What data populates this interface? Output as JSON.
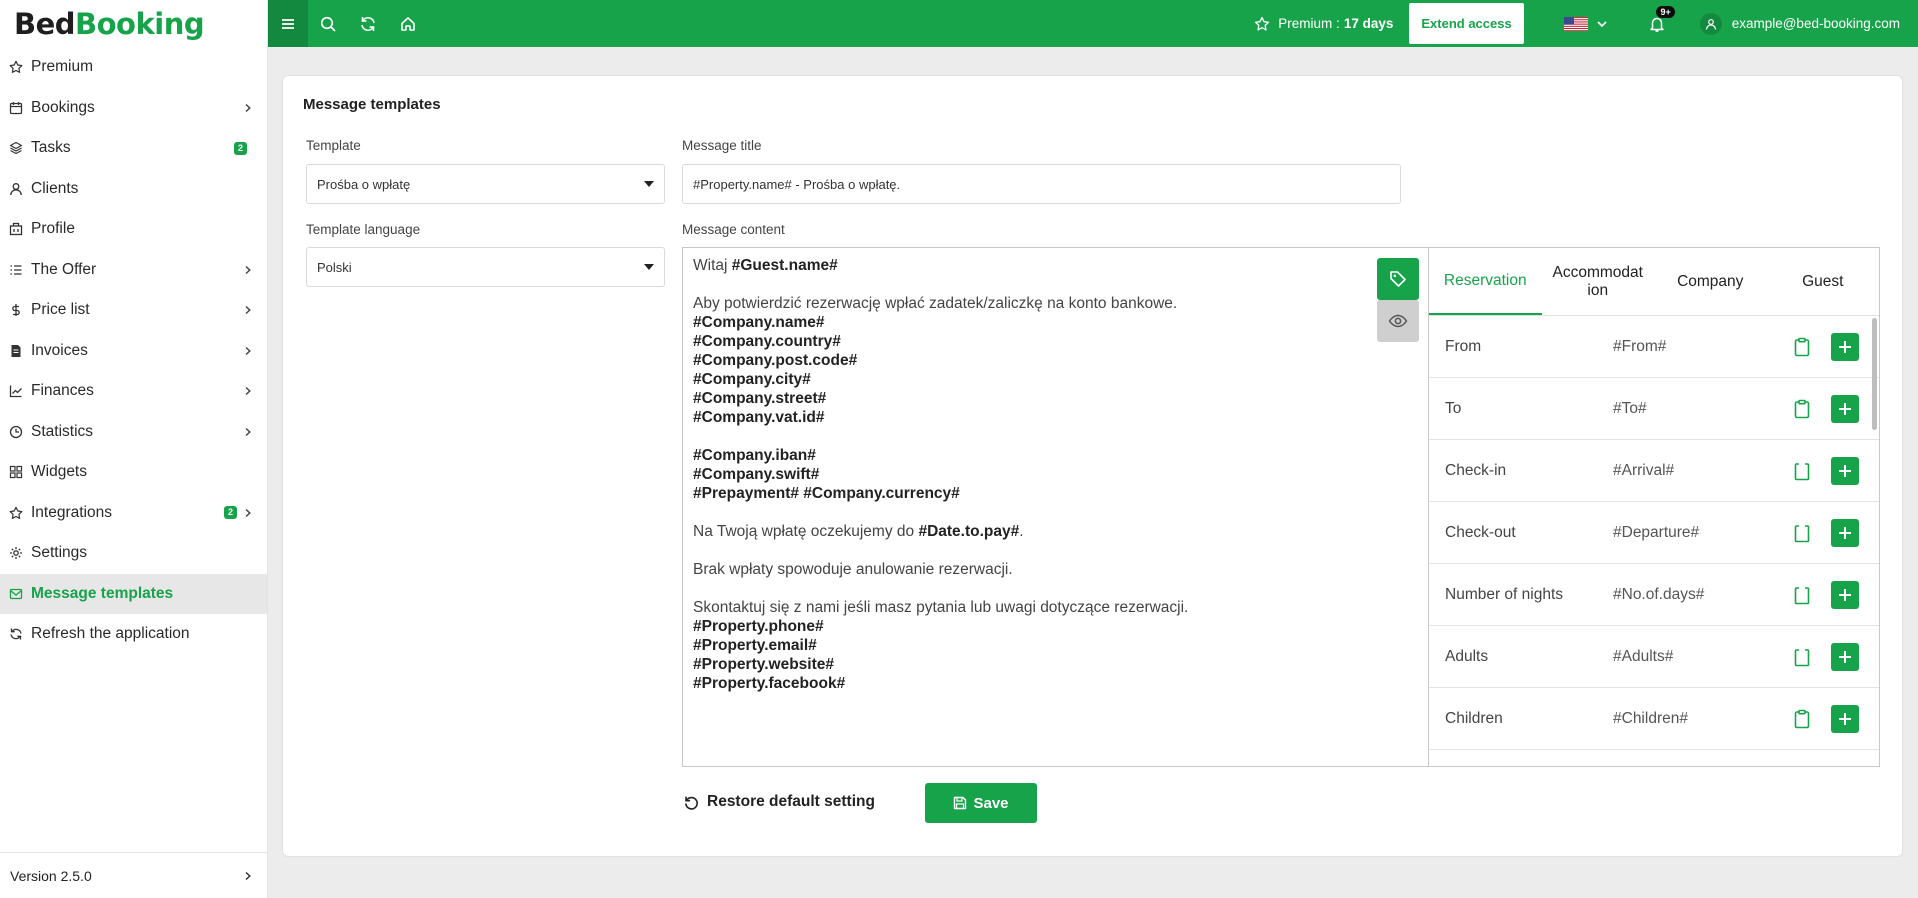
{
  "brand": {
    "part1": "Bed",
    "part2": "Booking"
  },
  "sidebar": {
    "items": [
      {
        "label": "Premium",
        "icon": "star-icon"
      },
      {
        "label": "Bookings",
        "icon": "calendar-icon",
        "chevron": true
      },
      {
        "label": "Tasks",
        "icon": "layers-icon",
        "badge": "2"
      },
      {
        "label": "Clients",
        "icon": "user-icon"
      },
      {
        "label": "Profile",
        "icon": "building-icon"
      },
      {
        "label": "The Offer",
        "icon": "list-icon",
        "chevron": true
      },
      {
        "label": "Price list",
        "icon": "dollar-icon",
        "chevron": true
      },
      {
        "label": "Invoices",
        "icon": "invoice-icon",
        "chevron": true
      },
      {
        "label": "Finances",
        "icon": "chart-icon",
        "chevron": true
      },
      {
        "label": "Statistics",
        "icon": "clock-icon",
        "chevron": true
      },
      {
        "label": "Widgets",
        "icon": "grid-icon"
      },
      {
        "label": "Integrations",
        "icon": "star-icon",
        "badge": "2",
        "chevron": true
      },
      {
        "label": "Settings",
        "icon": "gear-icon"
      },
      {
        "label": "Message templates",
        "icon": "mail-icon",
        "active": true
      },
      {
        "label": "Refresh the application",
        "icon": "refresh-icon"
      }
    ],
    "version": "Version 2.5.0"
  },
  "topbar": {
    "premium_label": "Premium :",
    "premium_days": "17 days",
    "extend_label": "Extend access",
    "notifications": "9+",
    "user_email": "example@bed-booking.com"
  },
  "page": {
    "title": "Message templates",
    "template_label": "Template",
    "template_value": "Prośba o wpłatę",
    "language_label": "Template language",
    "language_value": "Polski",
    "msg_title_label": "Message title",
    "msg_title_value": "#Property.name# - Prośba o wpłatę.",
    "msg_content_label": "Message content",
    "restore_label": "Restore default setting",
    "save_label": "Save"
  },
  "editor": {
    "lines": [
      [
        {
          "t": "Witaj "
        },
        {
          "t": "#Guest.name#",
          "b": true
        }
      ],
      [],
      [
        {
          "t": "Aby potwierdzić rezerwację wpłać zadatek/zaliczkę na konto bankowe."
        }
      ],
      [
        {
          "t": "#Company.name#",
          "b": true
        }
      ],
      [
        {
          "t": "#Company.country#",
          "b": true
        }
      ],
      [
        {
          "t": "#Company.post.code#",
          "b": true
        }
      ],
      [
        {
          "t": "#Company.city#",
          "b": true
        }
      ],
      [
        {
          "t": "#Company.street#",
          "b": true
        }
      ],
      [
        {
          "t": "#Company.vat.id#",
          "b": true
        }
      ],
      [],
      [
        {
          "t": "#Company.iban#",
          "b": true
        }
      ],
      [
        {
          "t": "#Company.swift#",
          "b": true
        }
      ],
      [
        {
          "t": "#Prepayment# #Company.currency#",
          "b": true
        }
      ],
      [],
      [
        {
          "t": "Na Twoją wpłatę oczekujemy do "
        },
        {
          "t": "#Date.to.pay#",
          "b": true
        },
        {
          "t": "."
        }
      ],
      [],
      [
        {
          "t": "Brak wpłaty spowoduje anulowanie rezerwacji."
        }
      ],
      [],
      [
        {
          "t": "Skontaktuj się z nami jeśli masz pytania lub uwagi dotyczące rezerwacji."
        }
      ],
      [
        {
          "t": "#Property.phone#",
          "b": true
        }
      ],
      [
        {
          "t": "#Property.email#",
          "b": true
        }
      ],
      [
        {
          "t": "#Property.website#",
          "b": true
        }
      ],
      [
        {
          "t": "#Property.facebook#",
          "b": true
        }
      ]
    ]
  },
  "variables": {
    "tabs": [
      {
        "label": "Reservation",
        "active": true
      },
      {
        "label": "Accommodat ion"
      },
      {
        "label": "Company"
      },
      {
        "label": "Guest"
      }
    ],
    "rows": [
      {
        "name": "From",
        "code": "#From#",
        "clip": "full"
      },
      {
        "name": "To",
        "code": "#To#",
        "clip": "full"
      },
      {
        "name": "Check-in",
        "code": "#Arrival#",
        "clip": "empty"
      },
      {
        "name": "Check-out",
        "code": "#Departure#",
        "clip": "empty"
      },
      {
        "name": "Number of nights",
        "code": "#No.of.days#",
        "clip": "empty"
      },
      {
        "name": "Adults",
        "code": "#Adults#",
        "clip": "empty"
      },
      {
        "name": "Children",
        "code": "#Children#",
        "clip": "full"
      }
    ]
  },
  "colors": {
    "accent": "#16a34a",
    "accent_dark": "#12893f"
  }
}
